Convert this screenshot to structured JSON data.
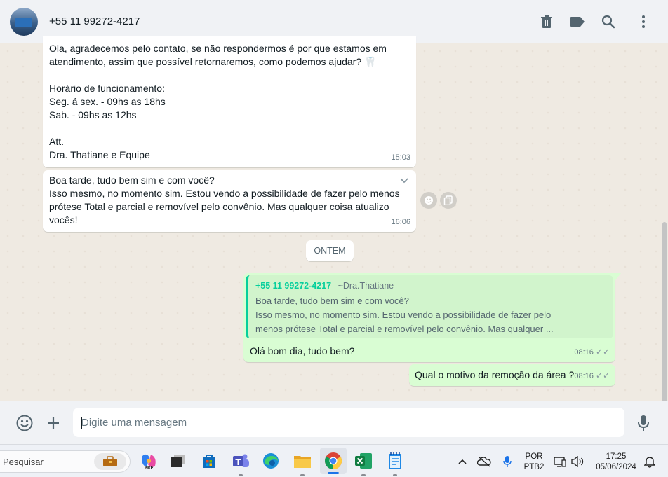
{
  "header": {
    "contact_name": "+55 11 99272-4217",
    "icons": [
      "trash-icon",
      "label-icon",
      "search-icon",
      "menu-dots-icon"
    ]
  },
  "messages": [
    {
      "direction": "in",
      "text": "Ola,  agradecemos pelo contato, se não respondermos é por que estamos em\natendimento, assim que possível retornaremos, como podemos ajudar? 🦷\n\nHorário de funcionamento:\nSeg. á sex. - 09hs as 18hs\nSab. - 09hs as 12hs\n\nAtt.\nDra. Thatiane e Equipe",
      "time": "15:03"
    },
    {
      "direction": "in",
      "text": "Boa tarde, tudo bem sim e com você?\nIsso mesmo, no momento sim. Estou vendo a possibilidade de fazer pelo menos prótese Total e parcial e removível pelo convênio. Mas qualquer coisa atualizo vocês!",
      "time": "16:06"
    },
    {
      "direction": "out",
      "quote": {
        "sender": "+55 11 99272-4217",
        "alias": "~Dra.Thatiane",
        "text": "Boa tarde, tudo bem sim e com você?\nIsso mesmo, no momento sim. Estou vendo a possibilidade de fazer pelo menos prótese Total e parcial e removível pelo convênio. Mas qualquer ..."
      },
      "text": "Olá bom dia, tudo bem?",
      "time": "08:16"
    },
    {
      "direction": "out",
      "text": "Qual o motivo da remoção da área ?",
      "time": "08:16"
    }
  ],
  "date_divider": "ONTEM",
  "ticks": "✓✓",
  "composer": {
    "placeholder": "Digite uma mensagem"
  },
  "taskbar": {
    "search_label": "Pesquisar",
    "lang_line1": "POR",
    "lang_line2": "PTB2",
    "time": "17:25",
    "date": "05/06/2024"
  },
  "colors": {
    "outgoing_bubble": "#d9fdd3",
    "quote_accent": "#06cf9c",
    "chat_background": "#efeae2"
  }
}
